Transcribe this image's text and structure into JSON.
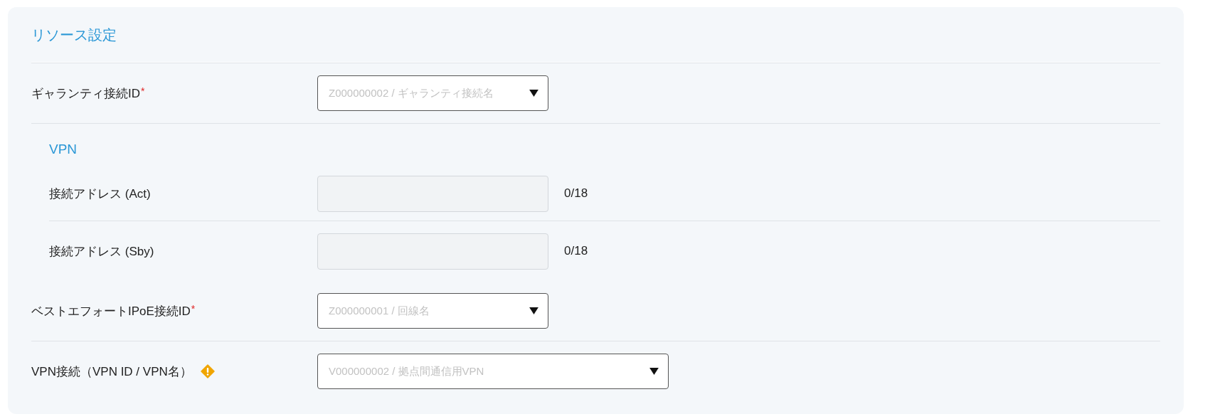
{
  "section_title": "リソース設定",
  "rows": [
    {
      "kind": "select",
      "label": "ギャランティ接続ID",
      "required": true,
      "required_mark": "*",
      "placeholder": "Z000000002 / ギャランティ接続名",
      "wide": false
    },
    {
      "kind": "group",
      "title": "VPN",
      "children": [
        {
          "kind": "text",
          "label": "接続アドレス (Act)",
          "disabled": true,
          "counter": "0/18"
        },
        {
          "kind": "text",
          "label": "接続アドレス (Sby)",
          "disabled": true,
          "counter": "0/18"
        }
      ]
    },
    {
      "kind": "select",
      "label": "ベストエフォートIPoE接続ID",
      "required": true,
      "required_mark": "*",
      "placeholder": "Z000000001 / 回線名",
      "wide": false
    },
    {
      "kind": "select",
      "label": "VPN接続（VPN ID / VPN名）",
      "required": false,
      "warning": true,
      "placeholder": "V000000002 / 拠点間通信用VPN",
      "wide": true
    }
  ]
}
